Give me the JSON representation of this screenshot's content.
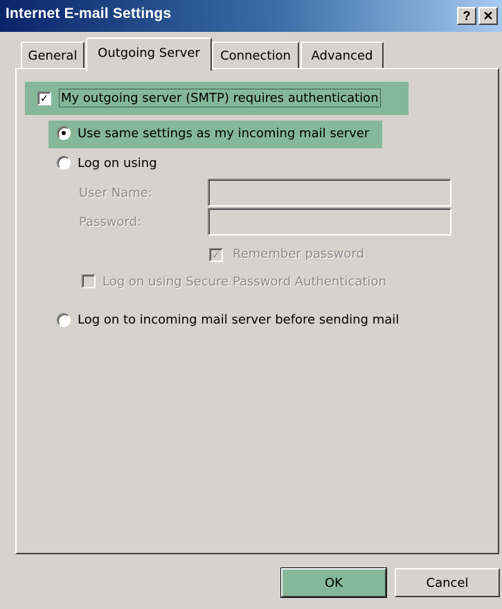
{
  "window": {
    "title": "Internet E-mail Settings",
    "help_glyph": "?",
    "close_glyph": "✕"
  },
  "tabs": [
    {
      "label": "General",
      "selected": false
    },
    {
      "label": "Outgoing Server",
      "selected": true
    },
    {
      "label": "Connection",
      "selected": false
    },
    {
      "label": "Advanced",
      "selected": false
    }
  ],
  "outgoing": {
    "smtp_auth": {
      "label": "My outgoing server (SMTP) requires authentication",
      "checked": true
    },
    "use_same": {
      "label": "Use same settings as my incoming mail server",
      "selected": true
    },
    "log_on_using": {
      "label": "Log on using",
      "selected": false
    },
    "user_name_label": "User Name:",
    "user_name_value": "",
    "password_label": "Password:",
    "password_value": "",
    "remember_password": {
      "label": "Remember password",
      "checked": true,
      "enabled": false
    },
    "spa": {
      "label": "Log on using Secure Password Authentication",
      "checked": false,
      "enabled": false
    },
    "log_on_incoming": {
      "label": "Log on to incoming mail server before sending mail",
      "selected": false
    }
  },
  "buttons": {
    "ok": "OK",
    "cancel": "Cancel"
  },
  "colors": {
    "dialog_bg": "#d6d3ce",
    "highlight": "#85b89a",
    "titlebar_start": "#0a246a",
    "titlebar_end": "#a6caf0",
    "disabled_text": "#8a8a8a"
  }
}
